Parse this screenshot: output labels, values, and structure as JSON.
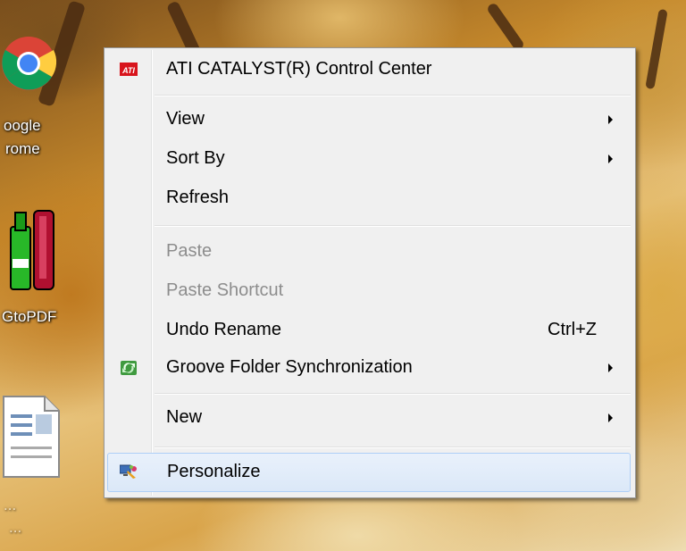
{
  "desktop": {
    "icons": [
      {
        "label_1": "oogle",
        "label_2": "rome"
      },
      {
        "label_1": "GtoPDF"
      },
      {
        "label_1": "...",
        "label_2": "..."
      }
    ]
  },
  "context_menu": {
    "items": [
      {
        "label": "ATI CATALYST(R) Control Center",
        "icon": "ati-logo-icon"
      },
      {
        "label": "View",
        "submenu": true
      },
      {
        "label": "Sort By",
        "submenu": true
      },
      {
        "label": "Refresh"
      },
      {
        "label": "Paste",
        "disabled": true
      },
      {
        "label": "Paste Shortcut",
        "disabled": true
      },
      {
        "label": "Undo Rename",
        "shortcut": "Ctrl+Z"
      },
      {
        "label": "Groove Folder Synchronization",
        "submenu": true,
        "icon": "groove-icon"
      },
      {
        "label": "New",
        "submenu": true
      },
      {
        "label": "Personalize",
        "icon": "personalize-icon",
        "highlighted": true
      }
    ]
  },
  "colors": {
    "menu_bg": "#f0f0f0",
    "highlight": "#dbe8f8",
    "disabled_text": "#8d8d8d",
    "ati_red": "#d8141c"
  }
}
